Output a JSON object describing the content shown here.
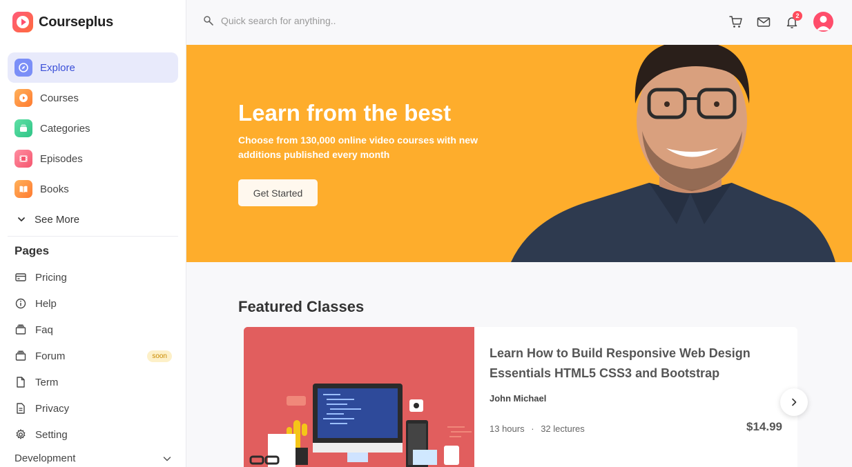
{
  "app": {
    "name": "Courseplus"
  },
  "sidebar": {
    "items": [
      {
        "label": "Explore",
        "icon": "compass-icon",
        "color": "#6f85f5",
        "active": true
      },
      {
        "label": "Courses",
        "icon": "play-icon",
        "color": "#ff8a3d"
      },
      {
        "label": "Categories",
        "icon": "layers-icon",
        "color": "#3fcf8e"
      },
      {
        "label": "Episodes",
        "icon": "film-icon",
        "color": "#ff6b81"
      },
      {
        "label": "Books",
        "icon": "book-icon",
        "color": "#ff8a3d"
      }
    ],
    "see_more": "See More",
    "pages_title": "Pages",
    "pages": [
      {
        "label": "Pricing",
        "icon": "credit-card-icon"
      },
      {
        "label": "Help",
        "icon": "info-icon"
      },
      {
        "label": "Faq",
        "icon": "archive-icon"
      },
      {
        "label": "Forum",
        "icon": "forum-icon",
        "badge": "soon"
      },
      {
        "label": "Term",
        "icon": "document-icon"
      },
      {
        "label": "Privacy",
        "icon": "document-text-icon"
      },
      {
        "label": "Setting",
        "icon": "gear-icon"
      }
    ],
    "development": "Development"
  },
  "header": {
    "search_placeholder": "Quick search for anything..",
    "notifications_count": "2"
  },
  "hero": {
    "title": "Learn from the best",
    "subtitle": "Choose from 130,000 online video courses with new additions published every month",
    "button": "Get Started",
    "bg_color": "#fead2c"
  },
  "featured": {
    "title": "Featured Classes",
    "course": {
      "title": "Learn How to Build Responsive Web Design Essentials HTML5 CSS3 and Bootstrap",
      "author": "John Michael",
      "hours": "13 hours",
      "separator": "·",
      "lectures": "32 lectures",
      "price": "$14.99"
    }
  }
}
